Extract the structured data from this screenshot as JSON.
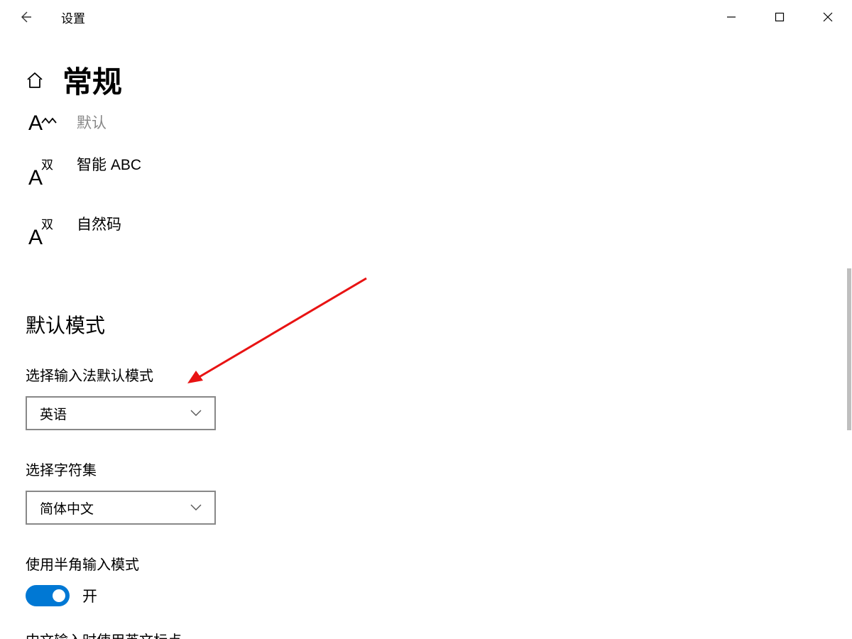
{
  "titlebar": {
    "title": "设置"
  },
  "page": {
    "title": "常规"
  },
  "ime": {
    "items": [
      {
        "icon_sup": "˄˄",
        "label": "默认"
      },
      {
        "icon_sup": "双",
        "label": "智能 ABC"
      },
      {
        "icon_sup": "双",
        "label": "自然码"
      }
    ]
  },
  "sections": {
    "default_mode_title": "默认模式",
    "input_mode_label": "选择输入法默认模式",
    "input_mode_value": "英语",
    "charset_label": "选择字符集",
    "charset_value": "简体中文",
    "halfwidth_label": "使用半角输入模式",
    "halfwidth_state": "开",
    "cutoff_label": "中文输入时使用英文标点"
  },
  "colors": {
    "accent": "#0078d4",
    "annotation": "#e81313"
  }
}
